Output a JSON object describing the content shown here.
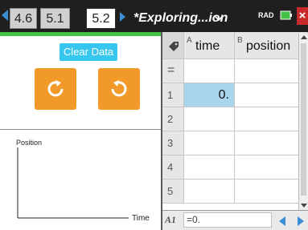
{
  "tabs": [
    {
      "label": "4.6",
      "active": false
    },
    {
      "label": "5.1",
      "active": false
    },
    {
      "label": "5.2",
      "active": true
    }
  ],
  "document_title": "*Exploring...ion",
  "angle_mode": "RAD",
  "left_panel": {
    "clear_button_label": "Clear Data",
    "reset_button_icon": "rotate-clockwise-icon",
    "undo_button_icon": "rotate-counterclockwise-icon",
    "plot": {
      "y_axis_label": "Position",
      "x_axis_label": "Time"
    }
  },
  "spreadsheet": {
    "columns": [
      {
        "letter": "A",
        "name": "time"
      },
      {
        "letter": "B",
        "name": "position"
      }
    ],
    "formula_row_symbol": "=",
    "rows": [
      {
        "num": "1",
        "time": "0.",
        "position": ""
      },
      {
        "num": "2",
        "time": "",
        "position": ""
      },
      {
        "num": "3",
        "time": "",
        "position": ""
      },
      {
        "num": "4",
        "time": "",
        "position": ""
      },
      {
        "num": "5",
        "time": "",
        "position": ""
      }
    ],
    "selected_cell": "A1",
    "entry_line": {
      "cell_ref": "A1",
      "value": "=0."
    }
  },
  "colors": {
    "accent_blue": "#3c8fd6",
    "clear_button": "#36c6ee",
    "action_button": "#f19a29",
    "progress_green": "#44c144",
    "selected_cell": "#a9d4ee",
    "close_red": "#c72a2a"
  }
}
